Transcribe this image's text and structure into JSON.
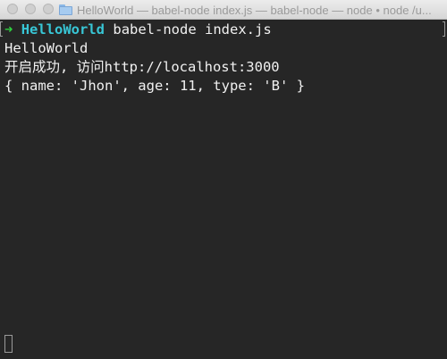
{
  "window": {
    "title": "HelloWorld — babel-node index.js — babel-node — node • node /u..."
  },
  "terminal": {
    "prompt": {
      "arrow": "➜",
      "directory": "HelloWorld",
      "command": "babel-node index.js"
    },
    "output": [
      "HelloWorld",
      "开启成功, 访问http://localhost:3000",
      "{ name: 'Jhon', age: 11, type: 'B' }"
    ]
  },
  "colors": {
    "background": "#262626",
    "prompt_arrow": "#2fcf3f",
    "prompt_directory": "#38c6d6",
    "text": "#f0f0f0"
  },
  "icons": {
    "title_folder": "folder-icon"
  }
}
